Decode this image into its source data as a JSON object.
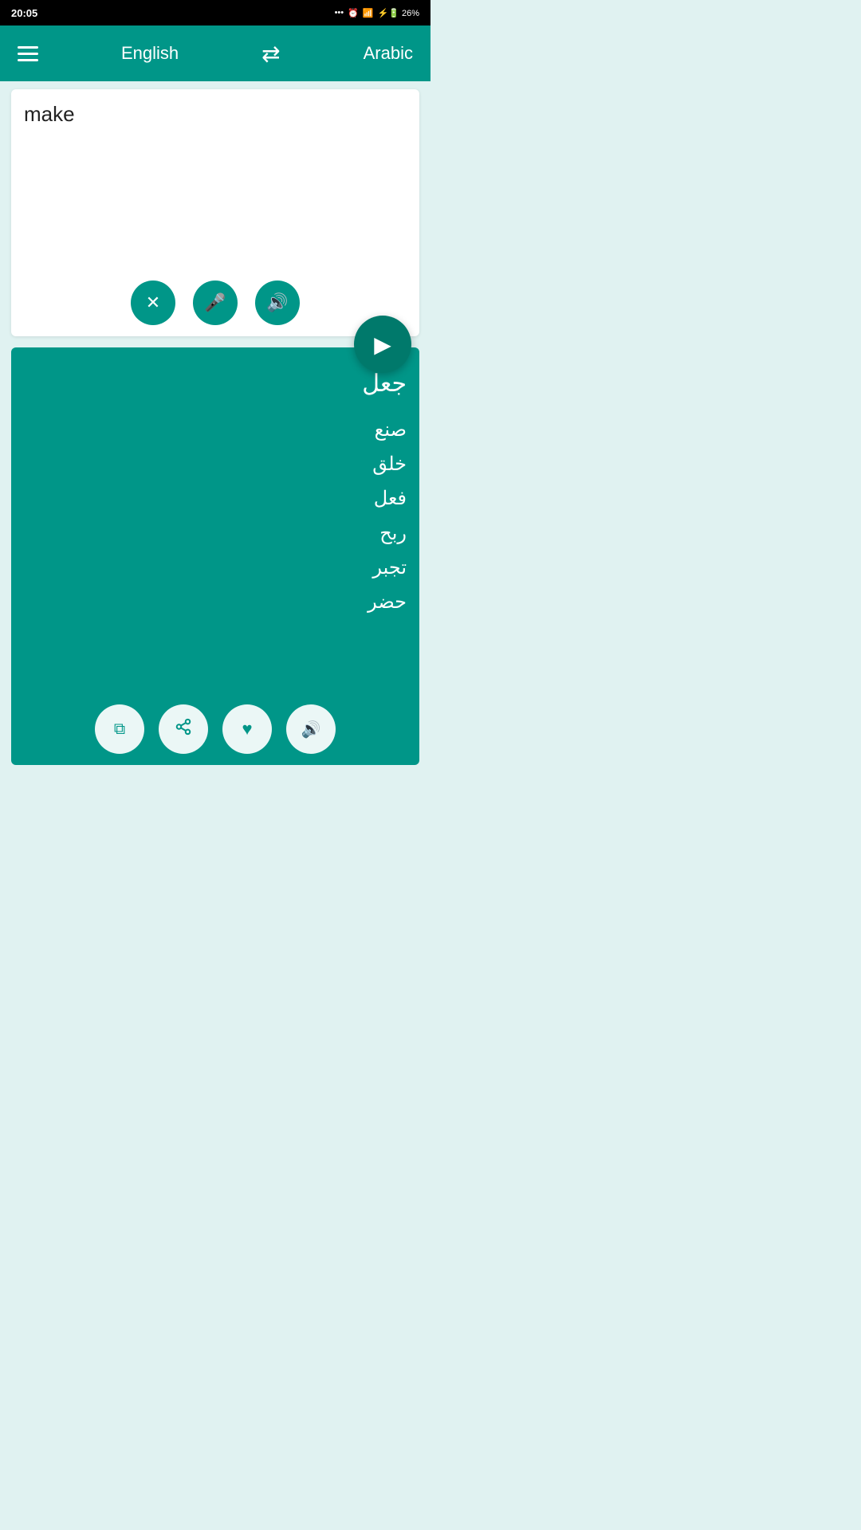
{
  "statusBar": {
    "time": "20:05",
    "icons": "... ⏰ 🔋 26%"
  },
  "topBar": {
    "sourceLang": "English",
    "targetLang": "Arabic",
    "swapLabel": "⇄"
  },
  "inputArea": {
    "inputText": "make",
    "placeholder": "",
    "clearLabel": "×",
    "micLabel": "🎤",
    "speakerLabel": "🔊"
  },
  "translateButton": {
    "label": "▶"
  },
  "outputArea": {
    "translationLines": [
      "جعل",
      "",
      "صنع",
      "خلق",
      "فعل",
      "ربح",
      "تجبر",
      "حضر"
    ],
    "copyLabel": "⧉",
    "shareLabel": "⤴",
    "favoriteLabel": "♥",
    "speakerLabel": "🔊"
  }
}
